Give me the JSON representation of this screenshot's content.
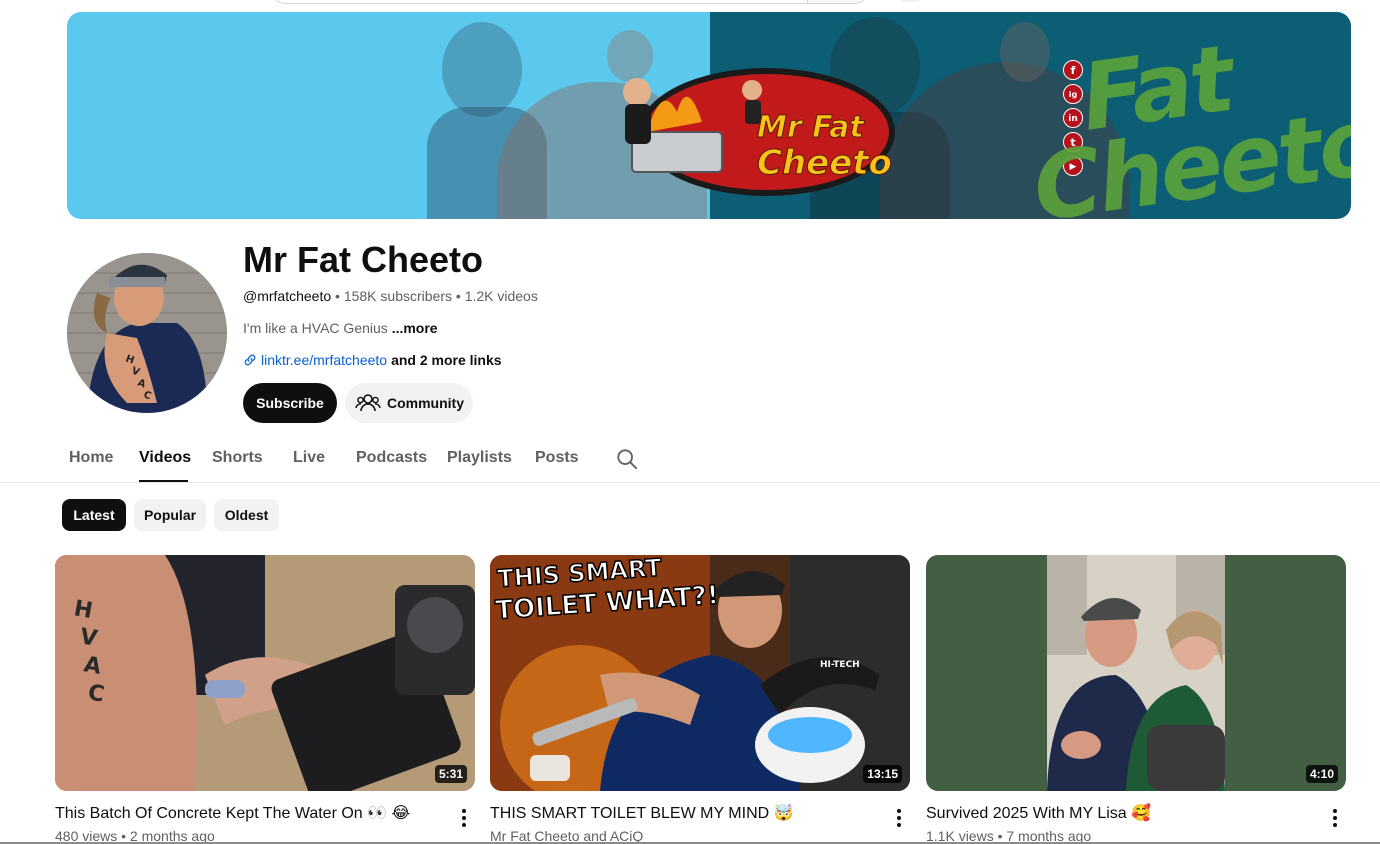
{
  "channel": {
    "name": "Mr Fat Cheeto",
    "handle": "@mrfatcheeto",
    "subscribers": "158K subscribers",
    "videos_count": "1.2K videos",
    "separator": "•",
    "description": "I'm like a HVAC Genius",
    "description_more": "...more",
    "link_url": "linktr.ee/mrfatcheeto",
    "link_more": "and 2 more links"
  },
  "banner": {
    "logo_line1": "Mr Fat",
    "logo_line2": "Cheeto",
    "word_line1": "Fat",
    "word_line2": "Cheeto",
    "social_icons": [
      "f",
      "ig",
      "in",
      "t",
      "▶"
    ],
    "colors": {
      "left": "#5bc8ee",
      "right": "#0b5e74",
      "accent": "#f7c31b",
      "red": "#b5121b"
    }
  },
  "actions": {
    "subscribe_label": "Subscribe",
    "community_label": "Community"
  },
  "tabs": [
    {
      "label": "Home"
    },
    {
      "label": "Videos",
      "active": true
    },
    {
      "label": "Shorts"
    },
    {
      "label": "Live"
    },
    {
      "label": "Podcasts"
    },
    {
      "label": "Playlists"
    },
    {
      "label": "Posts"
    }
  ],
  "chips": [
    {
      "label": "Latest",
      "active": true
    },
    {
      "label": "Popular"
    },
    {
      "label": "Oldest"
    }
  ],
  "videos": [
    {
      "title": "This Batch Of Concrete Kept The Water On 👀 😂",
      "meta": "480 views • 2 months ago",
      "duration": "5:31"
    },
    {
      "title": "THIS SMART TOILET BLEW MY MIND 🤯",
      "meta": "Mr Fat Cheeto and ACiQ",
      "duration": "13:15",
      "thumb_text_1": "THIS SMART",
      "thumb_text_2": "TOILET WHAT?!",
      "toilet_brand": "HI-TECH"
    },
    {
      "title": "Survived 2025 With MY Lisa 🥰",
      "meta": "1.1K views • 7 months ago",
      "duration": "4:10"
    }
  ],
  "icons": {
    "link": "link-icon",
    "community": "people-icon",
    "search": "search-icon",
    "menu": "more-vert-icon"
  }
}
